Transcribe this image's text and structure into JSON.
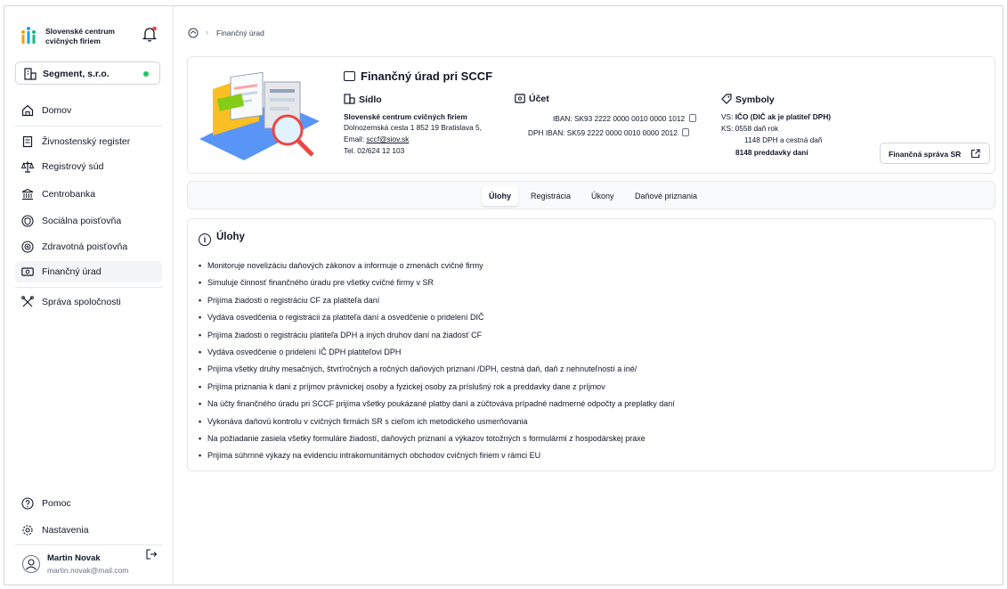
{
  "sidebar": {
    "org_line1": "Slovenské centrum",
    "org_line2": "cvičných firiem",
    "company": "Segment, s.r.o.",
    "status_color": "#22c55e",
    "nav": [
      {
        "label": "Domov",
        "icon": "home-icon"
      },
      {
        "label": "Živnostenský register",
        "icon": "register-icon"
      },
      {
        "label": "Registrový súd",
        "icon": "scales-icon"
      },
      {
        "label": "Centrobanka",
        "icon": "bank-icon"
      },
      {
        "label": "Sociálna poisťovňa",
        "icon": "shield-icon"
      },
      {
        "label": "Zdravotná poisťovňa",
        "icon": "health-icon"
      },
      {
        "label": "Finančný úrad",
        "icon": "money-icon"
      },
      {
        "label": "Správa spoločnosti",
        "icon": "tools-icon"
      }
    ],
    "help": "Pomoc",
    "settings": "Nastavenia",
    "user": {
      "name": "Martin Novak",
      "email": "martin.novak@mail.com"
    }
  },
  "breadcrumb": {
    "current": "Finančný úrad"
  },
  "office": {
    "title": "Finančný úrad pri SCCF",
    "sidlo": {
      "heading": "Sídlo",
      "name": "Slovenské centrum cvičných firiem",
      "address": "Dolnozemská cesta 1 852 19 Bratislava 5,",
      "email_label": "Email:",
      "email": "sccf@siov.sk",
      "phone": "Tel. 02/624 12 103"
    },
    "ucet": {
      "heading": "Účet",
      "iban": "IBAN: SK93 2222 0000 0010 0000 1012",
      "dph_iban": "DPH IBAN: SK59 2222 0000 0010 0000 2012"
    },
    "symboly": {
      "heading": "Symboly",
      "vs_prefix": "VS: ",
      "vs": "IČO (DIČ ak je platiteľ DPH)",
      "ks": "KS: 0558 daň rok",
      "ks2": "1148 DPH a cestná daň",
      "ks3": "8148 preddavky daní"
    },
    "external_button": "Finančná správa SR"
  },
  "tabs": [
    "Úlohy",
    "Registrácia",
    "Úkony",
    "Daňové priznania"
  ],
  "active_tab": "Úlohy",
  "tasks": {
    "title": "Úlohy",
    "items": [
      "Monitoruje novelizáciu daňových zákonov a informuje o zmenách cvičné firmy",
      "Simuluje činnosť finančného úradu pre všetky cvičné firmy v SR",
      "Prijíma žiadosti o registráciu CF za platiteľa daní",
      "Vydáva osvedčenia o registrácii za platiteľa daní a osvedčenie o pridelení DIČ",
      "Prijíma žiadosti o registráciu platiteľa DPH a iných druhov daní na žiadosť CF",
      "Vydáva osvedčenie o pridelení IČ DPH platiteľovi DPH",
      "Prijíma všetky druhy mesačných, štvrťročných a ročných daňových priznaní /DPH, cestná daň, daň z nehnuteľností a iné/",
      "Prijíma priznania k dani z príjmov právnickej osoby a fyzickej osoby za príslušný rok a preddavky dane z príjmov",
      "Na účty finančného úradu pri SCCF prijíma všetky poukázané platby daní a zúčtováva prípadné nadmerné odpočty a preplatky daní",
      "Vykonáva daňovú kontrolu v cvičných firmách SR s cieľom ich metodického usmerňovania",
      "Na požiadanie zasiela všetky formuláre žiadostí, daňových priznaní a výkazov totožných s formulármi z hospodárskej praxe",
      "Prijíma súhrnné výkazy na evidenciu intrakomunitárnych obchodov cvičných firiem v rámci EU"
    ]
  }
}
